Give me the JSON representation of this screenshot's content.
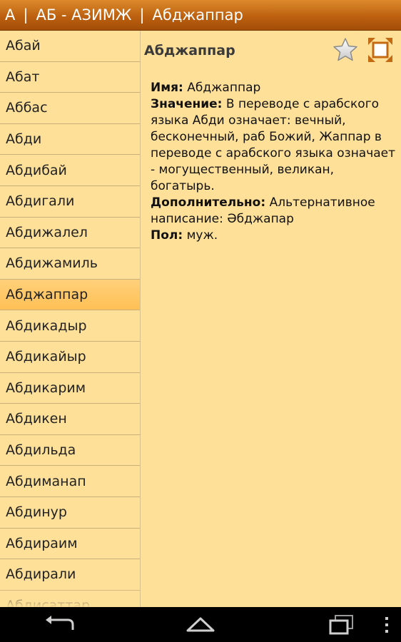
{
  "titlebar": {
    "letter": "А",
    "range": "АБ - АЗИМЖ",
    "current": "Абджаппар"
  },
  "list": {
    "items": [
      "Абай",
      "Абат",
      "Аббас",
      "Абди",
      "Абдибай",
      "Абдигали",
      "Абдижалел",
      "Абдижамиль",
      "Абджаппар",
      "Абдикадыр",
      "Абдикайыр",
      "Абдикарим",
      "Абдикен",
      "Абдильда",
      "Абдиманап",
      "Абдинур",
      "Абдираим",
      "Абдирали",
      "Абдисаттар"
    ],
    "selected_index": 8
  },
  "detail": {
    "title": "Абджаппар",
    "name_label": "Имя:",
    "name_value": "Абджаппар",
    "meaning_label": "Значение:",
    "meaning_value": "В переводе с арабского языка Абди означает: вечный, бесконечный, раб Божий, Жаппар в переводе с арабского языка означает - могущественный, великан, богатырь.",
    "extra_label": "Дополнительно:",
    "extra_value": "Альтернативное написание: Әбджапар",
    "gender_label": "Пол:",
    "gender_value": "муж."
  },
  "icons": {
    "favorite": "star-icon",
    "fullscreen": "expand-icon",
    "back": "back-icon",
    "home": "home-icon",
    "recent": "recent-apps-icon",
    "menu": "overflow-menu-icon"
  },
  "colors": {
    "titlebar": "#bd6110",
    "background": "#ffe099",
    "selected": "#ffc055",
    "divider": "#c9b07a"
  }
}
